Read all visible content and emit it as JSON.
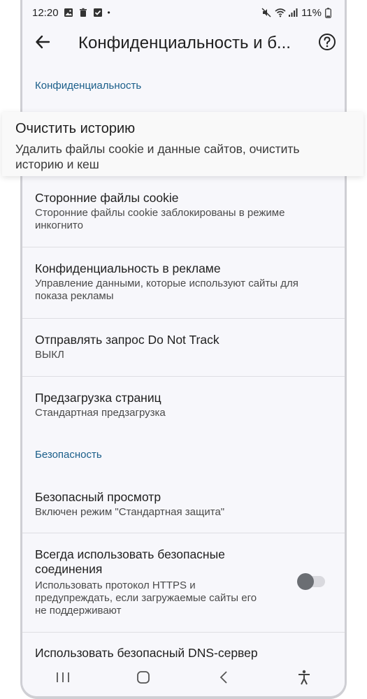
{
  "status_bar": {
    "time": "12:20",
    "battery": "11%",
    "dot": "•"
  },
  "app_bar": {
    "title": "Конфиденциальность и б..."
  },
  "sections": {
    "privacy": "Конфиденциальность",
    "security": "Безопасность"
  },
  "highlighted": {
    "title": "Очистить историю",
    "subtitle": "Удалить файлы cookie и данные сайтов, очистить историю и кеш"
  },
  "items": [
    {
      "title": "Сторонние файлы cookie",
      "subtitle": "Сторонние файлы cookie заблокированы в режиме инкогнито"
    },
    {
      "title": "Конфиденциальность в рекламе",
      "subtitle": "Управление данными, которые используют сайты для показа рекламы"
    },
    {
      "title": "Отправлять запрос Do Not Track",
      "subtitle": "ВЫКЛ"
    },
    {
      "title": "Предзагрузка страниц",
      "subtitle": "Стандартная предзагрузка"
    },
    {
      "title": "Безопасный просмотр",
      "subtitle": "Включен режим \"Стандартная защита\""
    },
    {
      "title": "Всегда использовать безопасные соединения",
      "subtitle": "Использовать протокол HTTPS и предупреждать, если загружаемые сайты его не поддерживают",
      "toggle_on": false
    },
    {
      "title": "Использовать безопасный DNS-сервер",
      "subtitle": ""
    }
  ],
  "colors": {
    "accent": "#1a5e8a",
    "background": "#f7f7fb"
  }
}
